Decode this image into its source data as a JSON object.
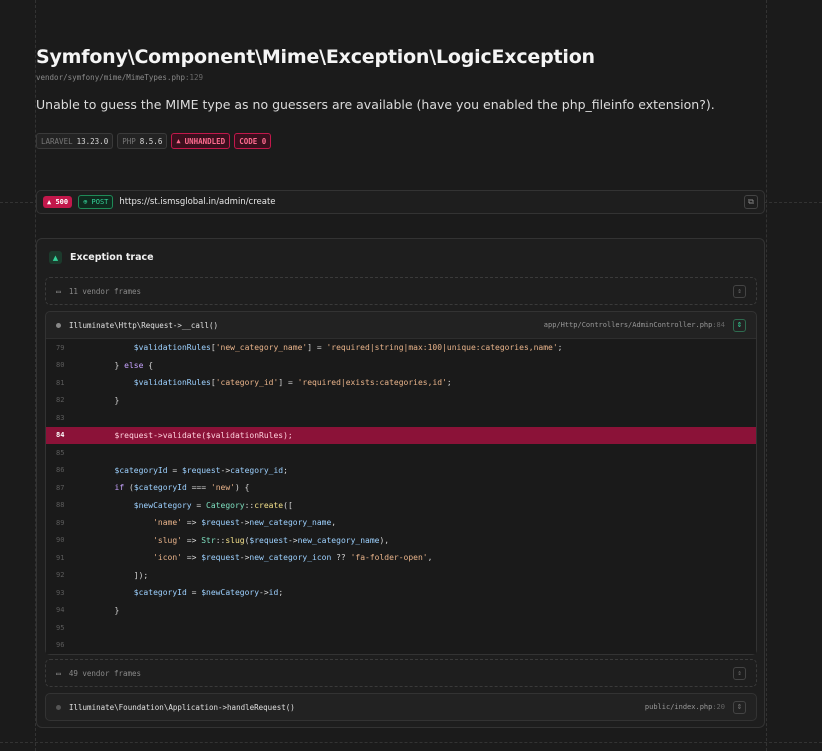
{
  "exception": {
    "class": "Symfony\\Component\\Mime\\Exception\\LogicException",
    "file": "vendor/symfony/mime/MimeTypes.php",
    "line": ":129",
    "message": "Unable to guess the MIME type as no guessers are available (have you enabled the php_fileinfo extension?)."
  },
  "badges": {
    "laravel_key": "LARAVEL",
    "laravel_val": "13.23.0",
    "php_key": "PHP",
    "php_val": "8.5.6",
    "unhandled": "UNHANDLED",
    "code": "CODE 0"
  },
  "request": {
    "status": "500",
    "method": "POST",
    "url": "https://st.ismsglobal.in/admin/create"
  },
  "trace": {
    "title": "Exception trace",
    "vendor_frames_top": "11 vendor frames",
    "vendor_frames_bottom": "49 vendor frames",
    "frame1": {
      "function": "Illuminate\\Http\\Request->__call()",
      "path": "app/Http/Controllers/AdminController.php",
      "line": ":84"
    },
    "frame2": {
      "function": "Illuminate\\Foundation\\Application->handleRequest()",
      "path": "public/index.php",
      "line": ":20"
    }
  },
  "code_lines": [
    {
      "n": "79",
      "t": "            $validationRules['new_category_name'] = 'required|string|max:100|unique:categories,name';"
    },
    {
      "n": "80",
      "t": "        } else {"
    },
    {
      "n": "81",
      "t": "            $validationRules['category_id'] = 'required|exists:categories,id';"
    },
    {
      "n": "82",
      "t": "        }"
    },
    {
      "n": "83",
      "t": ""
    },
    {
      "n": "84",
      "t": "        $request->validate($validationRules);"
    },
    {
      "n": "85",
      "t": ""
    },
    {
      "n": "86",
      "t": "        $categoryId = $request->category_id;"
    },
    {
      "n": "87",
      "t": "        if ($categoryId === 'new') {"
    },
    {
      "n": "88",
      "t": "            $newCategory = Category::create(["
    },
    {
      "n": "89",
      "t": "                'name' => $request->new_category_name,"
    },
    {
      "n": "90",
      "t": "                'slug' => Str::slug($request->new_category_name),"
    },
    {
      "n": "91",
      "t": "                'icon' => $request->new_category_icon ?? 'fa-folder-open',"
    },
    {
      "n": "92",
      "t": "            ]);"
    },
    {
      "n": "93",
      "t": "            $categoryId = $newCategory->id;"
    },
    {
      "n": "94",
      "t": "        }"
    },
    {
      "n": "95",
      "t": ""
    },
    {
      "n": "96",
      "t": ""
    }
  ],
  "highlight_line": "84",
  "colors": {
    "accent_red": "#c2184b",
    "highlight_bg": "#8b1238",
    "accent_green": "#34d399"
  }
}
